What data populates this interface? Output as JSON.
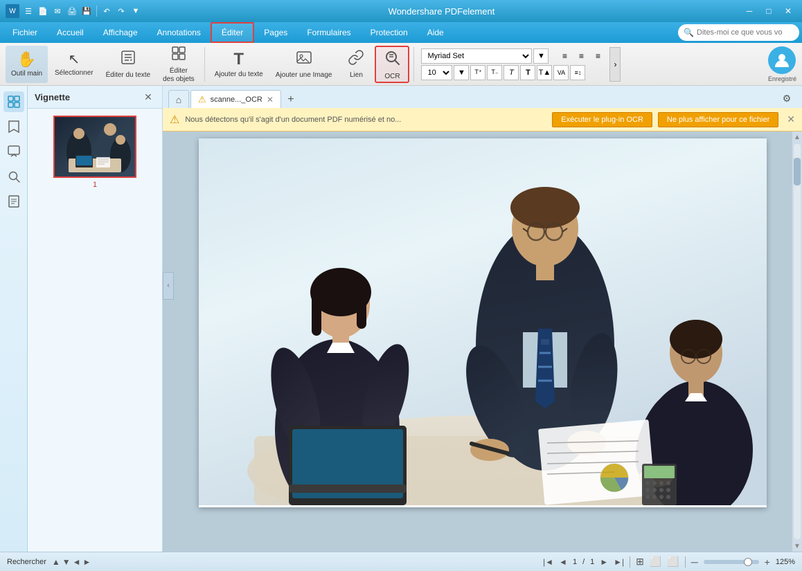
{
  "app": {
    "title": "Wondershare PDFelement",
    "window_controls": {
      "minimize": "─",
      "maximize": "□",
      "close": "✕"
    }
  },
  "title_bar": {
    "icons": [
      "☰",
      "📄",
      "✉",
      "🖨",
      "💾",
      "↶",
      "↷",
      "▼"
    ],
    "title": "Wondershare PDFelement"
  },
  "menu": {
    "items": [
      {
        "id": "fichier",
        "label": "Fichier"
      },
      {
        "id": "accueil",
        "label": "Accueil"
      },
      {
        "id": "affichage",
        "label": "Affichage"
      },
      {
        "id": "annotations",
        "label": "Annotations"
      },
      {
        "id": "editer",
        "label": "Éditer",
        "active": true
      },
      {
        "id": "pages",
        "label": "Pages"
      },
      {
        "id": "formulaires",
        "label": "Formulaires"
      },
      {
        "id": "protection",
        "label": "Protection"
      },
      {
        "id": "aide",
        "label": "Aide"
      }
    ],
    "search_placeholder": "Dites-moi ce que vous vo"
  },
  "ribbon": {
    "buttons": [
      {
        "id": "outil-main",
        "icon": "✋",
        "label": "Outil main",
        "selected": true
      },
      {
        "id": "selectionner",
        "icon": "↖",
        "label": "Sélectionner"
      },
      {
        "id": "editer-texte",
        "icon": "✏",
        "label": "Éditer du texte"
      },
      {
        "id": "editer-objets",
        "icon": "⊞",
        "label": "Éditer des objets"
      },
      {
        "id": "ajouter-texte",
        "icon": "T",
        "label": "Ajouter du texte"
      },
      {
        "id": "ajouter-image",
        "icon": "🖼",
        "label": "Ajouter une Image"
      },
      {
        "id": "lien",
        "icon": "🔗",
        "label": "Lien"
      },
      {
        "id": "ocr",
        "icon": "🔍",
        "label": "OCR",
        "active": true
      }
    ],
    "font": {
      "family": "Myriad Set",
      "size": "10",
      "formats": [
        "T+",
        "T-",
        "T",
        "T",
        "T",
        "T",
        "VA"
      ],
      "alignments": [
        "≡",
        "≡",
        "≡"
      ]
    }
  },
  "thumbnail_panel": {
    "title": "Vignette",
    "close_label": "✕",
    "pages": [
      {
        "number": "1"
      }
    ]
  },
  "tabs": {
    "home_icon": "⌂",
    "items": [
      {
        "id": "scanned",
        "label": "scanne..._OCR",
        "warning": true,
        "active": true
      }
    ],
    "new_tab": "+",
    "settings_icon": "⚙"
  },
  "ocr_bar": {
    "warning_icon": "⚠",
    "message": "Nous détectons qu'il s'agit d'un document PDF numérisé et no...",
    "btn_primary": "Exécuter le plug-in OCR",
    "btn_secondary": "Ne plus afficher pour ce fichier",
    "close": "✕"
  },
  "status_bar": {
    "search_label": "Rechercher",
    "search_up": "▲",
    "search_down": "▼",
    "search_prev": "◄",
    "search_next": "►",
    "page_current": "1",
    "page_total": "1",
    "page_separator": "/",
    "nav_first": "|◄",
    "nav_prev": "◄",
    "nav_next": "►",
    "nav_last": "►|",
    "view_icons": [
      "⊞",
      "⬜",
      "⬜"
    ],
    "zoom_minus": "─",
    "zoom_plus": "+",
    "zoom_percent": "125%"
  },
  "colors": {
    "accent_blue": "#2196c4",
    "header_blue": "#3ab0e5",
    "ocr_yellow": "#f0a000",
    "active_red": "#e04040",
    "sidebar_bg": "#e8f4fc"
  }
}
